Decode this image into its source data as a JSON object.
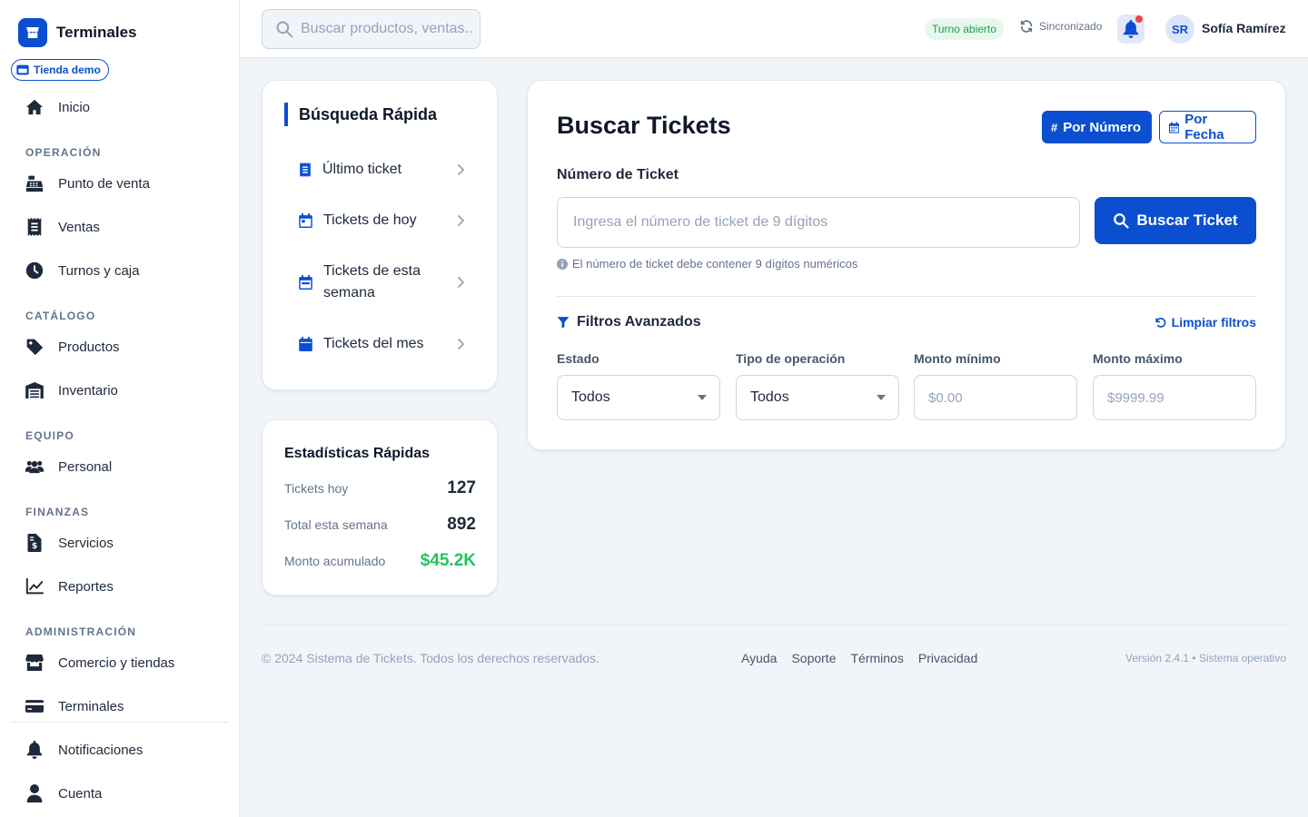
{
  "app": {
    "title": "Terminales",
    "store_badge": "Tienda demo",
    "brand_color": "#0b4fd0"
  },
  "sidebar": {
    "items": [
      {
        "label": "Inicio",
        "icon": "home-icon"
      },
      {
        "label": "Punto de venta",
        "icon": "cash-register-icon"
      },
      {
        "label": "Ventas",
        "icon": "receipt-icon"
      },
      {
        "label": "Turnos y caja",
        "icon": "clock-icon"
      },
      {
        "label": "Productos",
        "icon": "tag-icon"
      },
      {
        "label": "Inventario",
        "icon": "warehouse-icon"
      },
      {
        "label": "Personal",
        "icon": "users-icon"
      },
      {
        "label": "Servicios",
        "icon": "invoice-dollar-icon"
      },
      {
        "label": "Reportes",
        "icon": "chart-line-icon"
      },
      {
        "label": "Comercio y tiendas",
        "icon": "store-icon"
      },
      {
        "label": "Terminales",
        "icon": "credit-card-icon"
      },
      {
        "label": "Notificaciones",
        "icon": "bell-icon"
      },
      {
        "label": "Cuenta",
        "icon": "user-icon"
      }
    ],
    "sections": {
      "operacion": "OPERACIÓN",
      "catalogo": "CATÁLOGO",
      "equipo": "EQUIPO",
      "finanzas": "FINANZAS",
      "administracion": "ADMINISTRACIÓN"
    }
  },
  "header": {
    "search_placeholder": "Buscar productos, ventas...",
    "shift_status": "Turno abierto",
    "sync_status": "Sincronizado",
    "user_initials": "SR",
    "user_name": "Sofía Ramírez",
    "has_notification": true
  },
  "quick_search": {
    "title": "Búsqueda Rápida",
    "items": [
      {
        "label": "Último ticket",
        "icon": "receipt-icon"
      },
      {
        "label": "Tickets de hoy",
        "icon": "calendar-day-icon"
      },
      {
        "label": "Tickets de esta semana",
        "icon": "calendar-week-icon"
      },
      {
        "label": "Tickets del mes",
        "icon": "calendar-icon"
      }
    ]
  },
  "stats": {
    "title": "Estadísticas Rápidas",
    "rows": [
      {
        "label": "Tickets hoy",
        "value": "127"
      },
      {
        "label": "Total esta semana",
        "value": "892"
      },
      {
        "label": "Monto acumulado",
        "value": "$45.2K"
      }
    ]
  },
  "main": {
    "title": "Buscar Tickets",
    "tabs": [
      {
        "label": "Por Número",
        "active": true
      },
      {
        "label": "Por Fecha",
        "active": false
      }
    ],
    "ticket_label": "Número de Ticket",
    "ticket_placeholder": "Ingresa el número de ticket de 9 dígitos",
    "search_button": "Buscar Ticket",
    "hint": "El número de ticket debe contener 9 dígitos numéricos",
    "filters": {
      "title": "Filtros Avanzados",
      "clear": "Limpiar filtros",
      "estado_label": "Estado",
      "estado_value": "Todos",
      "tipo_label": "Tipo de operación",
      "tipo_value": "Todos",
      "min_label": "Monto mínimo",
      "min_placeholder": "$0.00",
      "max_label": "Monto máximo",
      "max_placeholder": "$9999.99"
    }
  },
  "footer": {
    "copyright": "© 2024 Sistema de Tickets. Todos los derechos reservados.",
    "links": [
      "Ayuda",
      "Soporte",
      "Términos",
      "Privacidad"
    ],
    "version": "Versión 2.4.1 • Sistema operativo"
  }
}
